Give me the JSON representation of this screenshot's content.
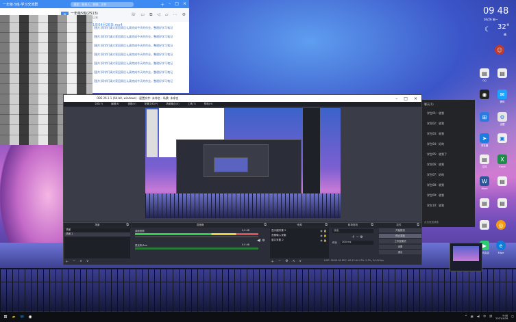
{
  "chat": {
    "search_placeholder": "搜索：联系人、群聊、文件",
    "title": "一年级·5班·学习交流群",
    "header_name": "一年级5班(2513)",
    "header_sub": "已连接手机模拟器以来",
    "header_avatar": "群",
    "top_link": "[文件] 截图2021年04月26日.mp4",
    "lines": [
      "[图片]同学们请大家回家后认真完成今天的作业，整理好学习笔记",
      "[图片]同学们请大家回家后认真完成今天的作业，整理好学习笔记",
      "[图片]同学们请大家回家后认真完成今天的作业，整理好学习笔记",
      "[图片]同学们请大家回家后认真完成今天的作业，整理好学习笔记",
      "[图片]同学们请大家回家后认真完成今天的作业，整理好学习笔记",
      "[图片]同学们请大家回家后认真完成今天的作业，整理好学习笔记",
      "[图片]同学们请大家回家后认真完成今天的作业，整理好学习笔记"
    ]
  },
  "desktop": {
    "clock": "09 48",
    "date": "04/26 周一",
    "weather_temp": "32°",
    "weather_sub": "晴",
    "icons": [
      {
        "label": "QQ"
      },
      {
        "label": "微信"
      },
      {
        "label": "浏览器"
      },
      {
        "label": "录屏"
      },
      {
        "label": "设置"
      },
      {
        "label": "文档"
      },
      {
        "label": "Word"
      },
      {
        "label": "Excel"
      },
      {
        "label": "PPT"
      },
      {
        "label": "Edge"
      },
      {
        "label": "腾讯会议"
      }
    ]
  },
  "side_chat": {
    "header": "聊天(1)",
    "rows": [
      "学生01：收到",
      "学生02：收到",
      "学生03：收到",
      "学生04：好的",
      "学生05：收到了",
      "学生06：收到",
      "学生07：好的",
      "学生08：收到",
      "学生09：收到",
      "学生10：收到"
    ],
    "footer": "点击发送消息"
  },
  "obs": {
    "title": "OBS 26.1.1 (64-bit, windows) - 配置文件: 未命名 - 场景: 未命名",
    "menu": [
      "文件(F)",
      "编辑(E)",
      "视图(V)",
      "配置文件(P)",
      "场景集合(S)",
      "工具(T)",
      "帮助(H)"
    ],
    "docks": {
      "scenes": "场景",
      "mixer": "混音器",
      "sources": "来源",
      "transitions": "转场特效",
      "controls": "控件"
    },
    "scenes": [
      "场景",
      "场景 2"
    ],
    "mixer": [
      {
        "name": "桌面音频",
        "level": "0.0 dB"
      },
      {
        "name": "麦克风/Aux",
        "level": "0.0 dB"
      }
    ],
    "sources": [
      "显示器采集 2",
      "音频输入采集",
      "窗口采集 2"
    ],
    "transition": {
      "name": "淡出",
      "duration_label": "时长",
      "duration": "300 ms"
    },
    "controls": [
      "开始推流",
      "停止录制",
      "工作室模式",
      "设置",
      "退出"
    ],
    "status": "LIVE: 00:00:00  REC: 00:12:44  CPU: 5.2%, 30.00 fps"
  },
  "taskbar": {
    "time": "9:48",
    "date": "2021/4/26",
    "tray": [
      "^",
      "中",
      "拼"
    ]
  }
}
